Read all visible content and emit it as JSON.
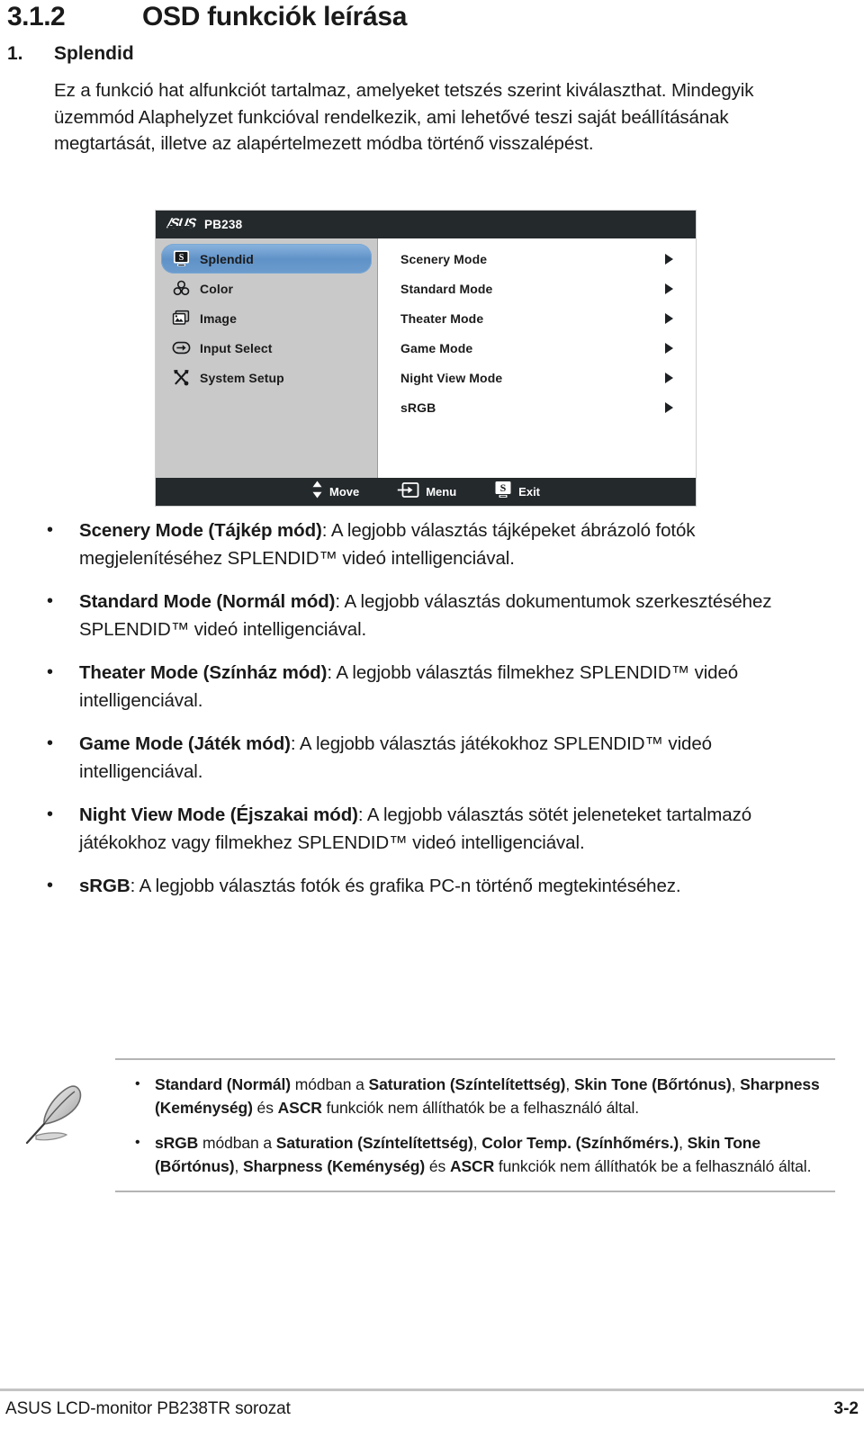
{
  "section": {
    "number": "3.1.2",
    "title": "OSD funkciók leírása"
  },
  "item": {
    "number": "1.",
    "title": "Splendid",
    "intro": "Ez a funkció hat alfunkciót tartalmaz, amelyeket tetszés szerint kiválaszthat. Mindegyik üzemmód Alaphelyzet funkcióval rendelkezik, ami lehetővé teszi saját beállításának megtartását, illetve az alapértelmezett módba történő visszalépést."
  },
  "osd": {
    "brand": "/SUS",
    "model": "PB238",
    "colors": {
      "chrome": "#24292c",
      "sidebar": "#c9c9c9",
      "highlight": "#5f92c8",
      "panel": "#ffffff"
    },
    "sidebar": [
      {
        "label": "Splendid",
        "icon": "splendid-monitor-icon",
        "selected": true
      },
      {
        "label": "Color",
        "icon": "color-circles-icon",
        "selected": false
      },
      {
        "label": "Image",
        "icon": "image-frames-icon",
        "selected": false
      },
      {
        "label": "Input Select",
        "icon": "input-arrow-icon",
        "selected": false
      },
      {
        "label": "System Setup",
        "icon": "wrench-screwdriver-icon",
        "selected": false
      }
    ],
    "options": [
      {
        "label": "Scenery Mode"
      },
      {
        "label": "Standard Mode"
      },
      {
        "label": "Theater Mode"
      },
      {
        "label": "Game Mode"
      },
      {
        "label": "Night View Mode"
      },
      {
        "label": "sRGB"
      }
    ],
    "footer": [
      {
        "label": "Move",
        "icon": "up-down-arrows-icon"
      },
      {
        "label": "Menu",
        "icon": "menu-enter-icon"
      },
      {
        "label": "Exit",
        "icon": "splendid-s-icon"
      }
    ]
  },
  "bullets": [
    {
      "dot": "•",
      "bold": "Scenery Mode (Tájkép mód)",
      "rest": ": A legjobb választás tájképeket ábrázoló fotók megjelenítéséhez SPLENDID™ videó intelligenciával."
    },
    {
      "dot": "•",
      "bold": "Standard Mode (Normál mód)",
      "rest": ": A legjobb választás dokumentumok szerkesztéséhez SPLENDID™ videó intelligenciával."
    },
    {
      "dot": "•",
      "bold": "Theater Mode (Színház mód)",
      "rest": ": A legjobb választás filmekhez SPLENDID™ videó intelligenciával."
    },
    {
      "dot": "•",
      "bold": "Game Mode (Játék mód)",
      "rest": ": A legjobb választás játékokhoz SPLENDID™ videó intelligenciával."
    },
    {
      "dot": "•",
      "bold": "Night View Mode (Éjszakai mód)",
      "rest": ": A legjobb választás sötét jeleneteket tartalmazó játékokhoz vagy filmekhez SPLENDID™ videó intelligenciával."
    },
    {
      "dot": "•",
      "bold": "sRGB",
      "rest": ": A legjobb választás fotók és grafika PC-n történő megtekintéséhez."
    }
  ],
  "note": {
    "icon": "quill-pen-icon",
    "bullets": [
      {
        "dot": "•",
        "parts": [
          {
            "text": "Standard (Normál)",
            "bold": true
          },
          {
            "text": " módban a ",
            "bold": false
          },
          {
            "text": "Saturation (Színtelítettség)",
            "bold": true
          },
          {
            "text": ", ",
            "bold": false
          },
          {
            "text": "Skin Tone (Bőrtónus)",
            "bold": true
          },
          {
            "text": ", ",
            "bold": false
          },
          {
            "text": "Sharpness (Keménység)",
            "bold": true
          },
          {
            "text": " és ",
            "bold": false
          },
          {
            "text": "ASCR",
            "bold": true
          },
          {
            "text": " funkciók nem állíthatók be a felhasználó által.",
            "bold": false
          }
        ]
      },
      {
        "dot": "•",
        "parts": [
          {
            "text": "sRGB",
            "bold": true
          },
          {
            "text": " módban a ",
            "bold": false
          },
          {
            "text": "Saturation (Színtelítettség)",
            "bold": true
          },
          {
            "text": ", ",
            "bold": false
          },
          {
            "text": "Color Temp. (Színhőmérs.)",
            "bold": true
          },
          {
            "text": ", ",
            "bold": false
          },
          {
            "text": "Skin Tone (Bőrtónus)",
            "bold": true
          },
          {
            "text": ", ",
            "bold": false
          },
          {
            "text": "Sharpness (Keménység)",
            "bold": true
          },
          {
            "text": " és ",
            "bold": false
          },
          {
            "text": "ASCR",
            "bold": true
          },
          {
            "text": " funkciók nem állíthatók be a felhasználó által.",
            "bold": false
          }
        ]
      }
    ]
  },
  "page_footer": {
    "left": "ASUS LCD-monitor PB238TR sorozat",
    "right": "3-2"
  }
}
